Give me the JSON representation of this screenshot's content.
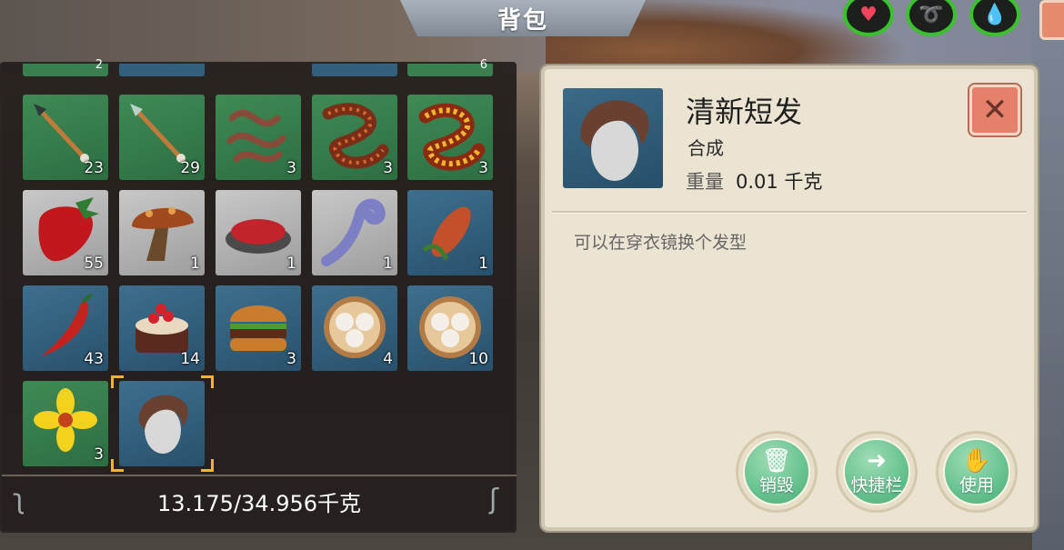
{
  "header": {
    "title": "背包"
  },
  "status_icons": [
    "heart-icon",
    "stamina-icon",
    "water-drop-icon"
  ],
  "inventory": {
    "partial_row_counts": [
      "2",
      "",
      "",
      "6"
    ],
    "slots": [
      {
        "item": "spear",
        "count": "23",
        "bg": "green"
      },
      {
        "item": "spear",
        "count": "29",
        "bg": "green"
      },
      {
        "item": "worms",
        "count": "3",
        "bg": "green"
      },
      {
        "item": "centipede",
        "count": "3",
        "bg": "green"
      },
      {
        "item": "golden-centipede",
        "count": "3",
        "bg": "green"
      },
      {
        "item": "strawberry",
        "count": "55",
        "bg": "grey"
      },
      {
        "item": "mushroom",
        "count": "1",
        "bg": "grey"
      },
      {
        "item": "berry-bowl",
        "count": "1",
        "bg": "grey"
      },
      {
        "item": "tentacle",
        "count": "1",
        "bg": "grey"
      },
      {
        "item": "corn",
        "count": "1",
        "bg": "blue"
      },
      {
        "item": "chili-pepper",
        "count": "43",
        "bg": "blue"
      },
      {
        "item": "berry-cake",
        "count": "14",
        "bg": "blue"
      },
      {
        "item": "burger",
        "count": "3",
        "bg": "blue"
      },
      {
        "item": "steamed-buns",
        "count": "4",
        "bg": "blue"
      },
      {
        "item": "steamed-buns",
        "count": "10",
        "bg": "blue"
      },
      {
        "item": "yellow-flower",
        "count": "3",
        "bg": "green"
      },
      {
        "item": "short-hair",
        "count": "",
        "bg": "blue"
      }
    ],
    "weight": "13.175/34.956千克"
  },
  "detail": {
    "name": "清新短发",
    "type": "合成",
    "weight_label": "重量",
    "weight_value": "0.01 千克",
    "description": "可以在穿衣镜换个发型",
    "actions": {
      "destroy": "销毁",
      "hotbar": "快捷栏",
      "use": "使用"
    }
  },
  "colors": {
    "slot_green": "#3f8a55",
    "slot_grey": "#b5b5b5",
    "slot_blue": "#33607c",
    "action_green": "#6bc494",
    "close_red": "#e5806a",
    "selection": "#f3b62b"
  }
}
